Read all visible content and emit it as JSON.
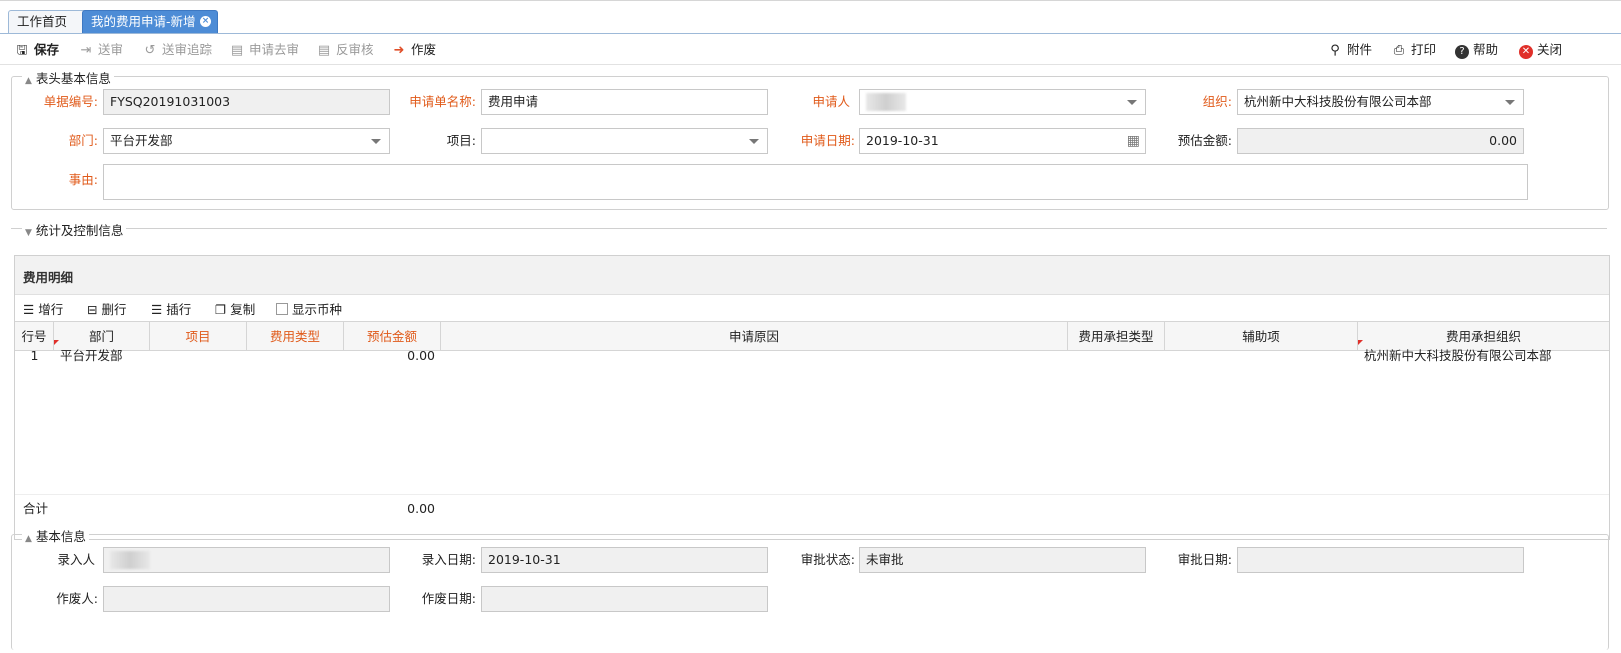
{
  "tabs": [
    {
      "label": "工作首页"
    },
    {
      "label": "我的费用申请-新增"
    }
  ],
  "toolbar": {
    "save": "保存",
    "submit": "送审",
    "track": "送审追踪",
    "withdraw": "申请去审",
    "unaudit": "反审核",
    "void": "作废",
    "attach": "附件",
    "print": "打印",
    "help": "帮助",
    "close": "关闭"
  },
  "header_section": {
    "legend": "表头基本信息",
    "doc_no_label": "单据编号:",
    "doc_no": "FYSQ20191031003",
    "name_label": "申请单名称:",
    "name": "费用申请",
    "applicant_label": "申请人",
    "org_label": "组织:",
    "org": "杭州新中大科技股份有限公司本部",
    "dept_label": "部门:",
    "dept": "平台开发部",
    "project_label": "项目:",
    "project": "",
    "date_label": "申请日期:",
    "date": "2019-10-31",
    "est_label": "预估金额:",
    "est": "0.00",
    "reason_label": "事由:",
    "reason": ""
  },
  "stats_section": {
    "legend": "统计及控制信息"
  },
  "detail": {
    "title": "费用明细",
    "tools": {
      "add": "增行",
      "del": "删行",
      "insert": "插行",
      "copy": "复制",
      "show_currency": "显示币种"
    },
    "columns": [
      "行号",
      "部门",
      "项目",
      "费用类型",
      "预估金额",
      "申请原因",
      "费用承担类型",
      "辅助项",
      "费用承担组织"
    ],
    "rows": [
      {
        "no": "1",
        "dept": "平台开发部",
        "project": "",
        "type": "",
        "amount": "0.00",
        "reason": "",
        "bear_type": "",
        "aux": "",
        "bear_org": "杭州新中大科技股份有限公司本部"
      }
    ],
    "total_label": "合计",
    "total_amount": "0.00"
  },
  "basic_section": {
    "legend": "基本信息",
    "entered_by_label": "录入人",
    "entered_date_label": "录入日期:",
    "entered_date": "2019-10-31",
    "status_label": "审批状态:",
    "status": "未审批",
    "approve_date_label": "审批日期:",
    "approve_date": "",
    "voided_by_label": "作废人:",
    "voided_by": "",
    "void_date_label": "作废日期:",
    "void_date": ""
  }
}
